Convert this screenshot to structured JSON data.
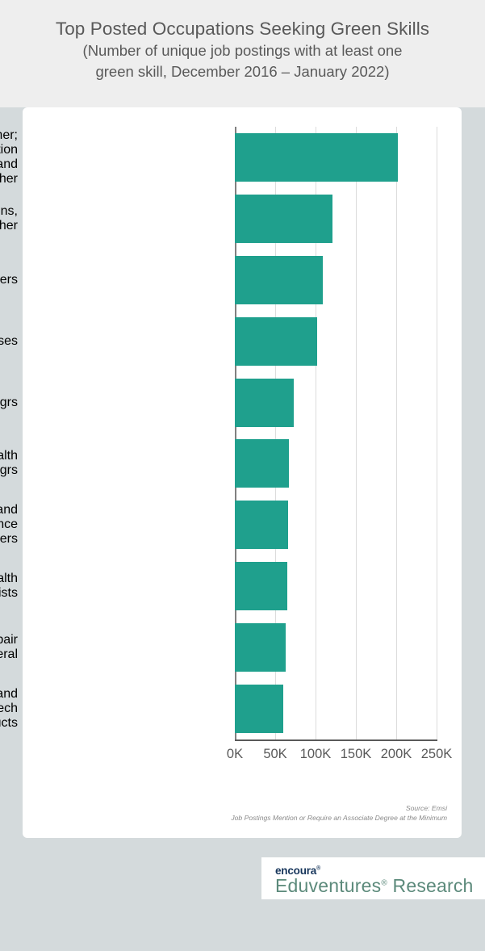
{
  "header": {
    "title_main": "Top Posted Occupations Seeking Green Skills",
    "title_sub_line1": "(Number of unique job postings with at least one",
    "title_sub_line2": "green skill, December 2016 – January 2022)"
  },
  "footer": {
    "source_line1": "Source: Emsi",
    "source_line2": "Job Postings Mention or Require an Associate Degree at the Minimum",
    "logo_primary": "encoura",
    "logo_primary_mark": "®",
    "logo_secondary": "Eduventures",
    "logo_secondary_mark": "®",
    "logo_secondary_suffix": " Research"
  },
  "colors": {
    "bar": "#1fa08d",
    "page_background": "#d4dadc",
    "top_band": "#eeeeee",
    "card": "#ffffff",
    "text": "#595959",
    "gridline": "#dcdcdc",
    "axis": "#595959",
    "logo_navy": "#16355b",
    "logo_green": "#5c8a7b"
  },
  "chart_data": {
    "type": "bar",
    "orientation": "horizontal",
    "title": "Top Posted Occupations Seeking Green Skills",
    "subtitle": "(Number of unique job postings with at least one green skill, December 2016 – January 2022)",
    "xlabel": "",
    "ylabel": "",
    "xlim": [
      0,
      250000
    ],
    "grid": true,
    "legend": "none",
    "tick_labels": [
      "0K",
      "50K",
      "100K",
      "150K",
      "200K",
      "250K"
    ],
    "tick_values": [
      0,
      50000,
      100000,
      150000,
      200000,
      250000
    ],
    "categories": [
      "Personal Service Mgrs, All Other;\nEntertainment and Recreation\nMgrs, Except Gambling; and\nMgrs, All Other",
      "Computer Occupations,\nAll Other",
      "Civil Engineers",
      "Registered Nurses",
      "General and Operations Mgrs",
      "Medical and Health\nServices Mgrs",
      "Software Developers and\nSoftware Quality Assurance\nAnalysts and Testers",
      "Occupational Health\nand Safety Specialists",
      "Maintenance and Repair\nWorkers, General",
      "Sales Reps, Wholesale and\nManufacturing, Except Tech\nand Scientific  Products"
    ],
    "values": [
      202000,
      121000,
      109000,
      102000,
      73000,
      67000,
      66000,
      65000,
      63000,
      60000
    ],
    "series": [
      {
        "name": "Unique job postings with at least one green skill",
        "values": [
          202000,
          121000,
          109000,
          102000,
          73000,
          67000,
          66000,
          65000,
          63000,
          60000
        ]
      }
    ]
  }
}
